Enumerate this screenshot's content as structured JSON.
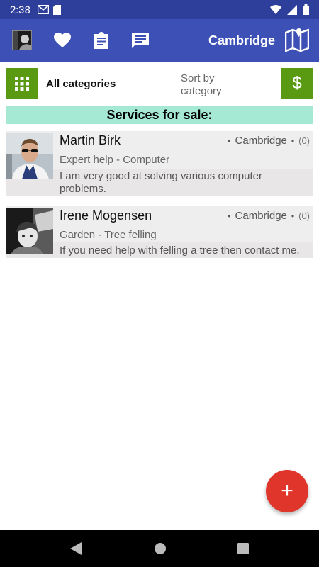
{
  "status_bar": {
    "time": "2:38"
  },
  "app_bar": {
    "title": "Cambridge"
  },
  "filter": {
    "category": "All categories",
    "sort_line1": "Sort by",
    "sort_line2": "category",
    "currency_symbol": "$"
  },
  "section": {
    "title": "Services for sale:"
  },
  "listings": [
    {
      "name": "Martin Birk",
      "location": "Cambridge",
      "count": "(0)",
      "category": "Expert help - Computer",
      "description_line1": "I am very good at solving various computer",
      "description_line2": "problems."
    },
    {
      "name": "Irene Mogensen",
      "location": "Cambridge",
      "count": "(0)",
      "category": "Garden - Tree felling",
      "description_line1": "If you need help with felling a tree then contact me."
    }
  ],
  "fab": {
    "label": "+"
  },
  "colors": {
    "status_bar": "#2e3e9b",
    "app_bar": "#3d50b5",
    "green_button": "#5a9a13",
    "section_header": "#a5e8d3",
    "fab": "#e0352b"
  }
}
